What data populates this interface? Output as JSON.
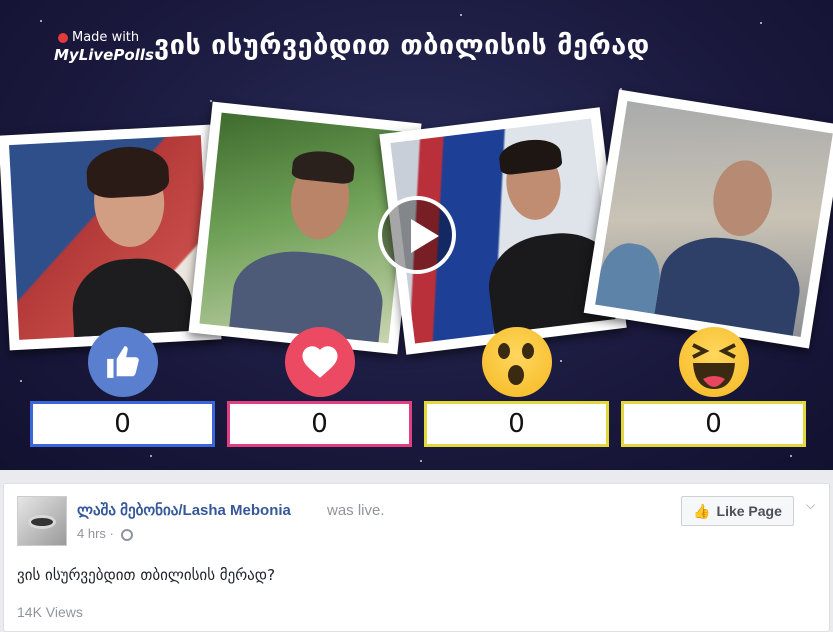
{
  "video": {
    "watermark": {
      "line1": "Made with",
      "line2": "MyLivePolls"
    },
    "title": "ვის ისურვებდით თბილისის მერად",
    "reactions": [
      {
        "id": "like",
        "icon": "like-thumb-icon",
        "color": "#5b7fcf",
        "count": "0",
        "box_color": "#3a66d8"
      },
      {
        "id": "love",
        "icon": "heart-icon",
        "color": "#ec4a63",
        "count": "0",
        "box_color": "#e03f82"
      },
      {
        "id": "wow",
        "icon": "wow-face-icon",
        "color": "#f5b821",
        "count": "0",
        "box_color": "#e3d83b"
      },
      {
        "id": "haha",
        "icon": "haha-face-icon",
        "color": "#f5b821",
        "count": "0",
        "box_color": "#e3d83b"
      }
    ]
  },
  "post": {
    "page_name": "ლაშა მებონია/Lasha Mebonia",
    "status": "was live.",
    "timestamp": "4 hrs ·",
    "like_page_label": "Like Page",
    "text": "ვის ისურვებდით თბილისის მერად?",
    "views": "14K Views"
  }
}
